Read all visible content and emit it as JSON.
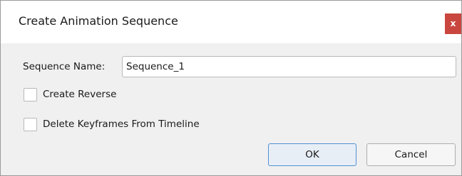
{
  "dialog": {
    "title": "Create Animation Sequence",
    "close_label": "x"
  },
  "form": {
    "sequence_name_label": "Sequence Name:",
    "sequence_name_value": "Sequence_1",
    "create_reverse_label": "Create Reverse",
    "create_reverse_checked": false,
    "delete_keyframes_label": "Delete Keyframes From Timeline",
    "delete_keyframes_checked": false
  },
  "buttons": {
    "ok_label": "OK",
    "cancel_label": "Cancel"
  },
  "colors": {
    "close_button": "#c9473e",
    "ok_border": "#4f90d6",
    "dialog_background": "#f0f0f0",
    "titlebar_background": "#ffffff"
  }
}
